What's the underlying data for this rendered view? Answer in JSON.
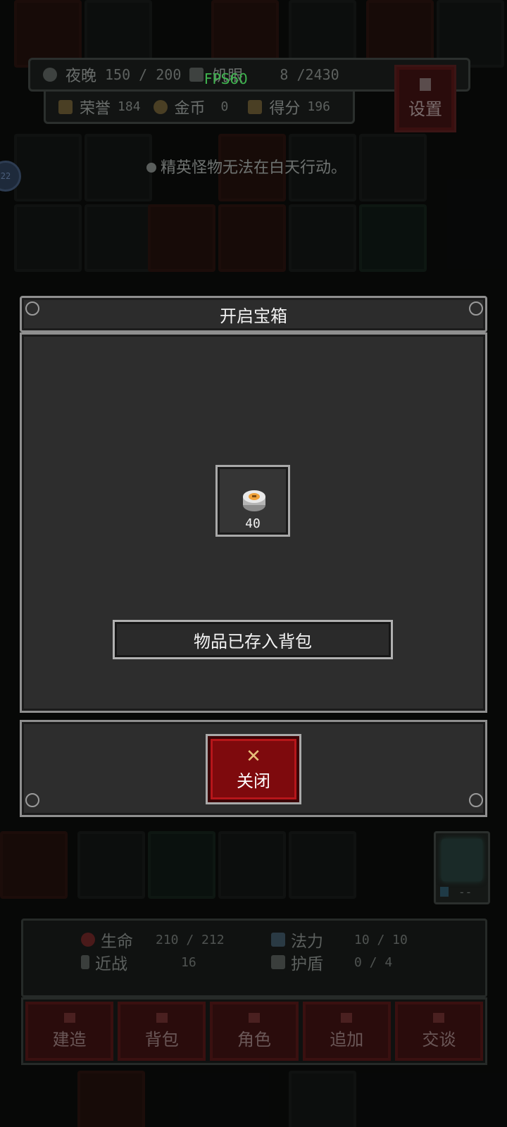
{
  "hud": {
    "fps": "FPS60",
    "phase_label": "夜晚",
    "phase_value": "150 / 200",
    "hunger_label": "饥眼",
    "hunger_value": "8 /2430",
    "honor_label": "荣誉",
    "honor_value": "184",
    "gold_label": "金币",
    "gold_value": "0",
    "score_label": "得分",
    "score_value": "196",
    "settings_label": "设置",
    "avatar_level": "22"
  },
  "notice": "精英怪物无法在白天行动。",
  "dialog": {
    "title": "开启宝箱",
    "item": {
      "icon": "silver-coin-icon",
      "quantity": "40"
    },
    "stored_message": "物品已存入背包",
    "close_label": "关闭"
  },
  "shield_slot": {
    "value": "--"
  },
  "stats": {
    "hp_label": "生命",
    "hp_value": "210 / 212",
    "mp_label": "法力",
    "mp_value": "10 / 10",
    "melee_label": "近战",
    "melee_value": "16",
    "shield_label": "护盾",
    "shield_value": "0 / 4"
  },
  "nav": [
    {
      "label": "建造",
      "icon": "hammer-icon"
    },
    {
      "label": "背包",
      "icon": "bag-icon"
    },
    {
      "label": "角色",
      "icon": "character-icon"
    },
    {
      "label": "追加",
      "icon": "plus-icon"
    },
    {
      "label": "交谈",
      "icon": "chat-icon"
    }
  ],
  "colors": {
    "close_button": "#7e0a0d",
    "fps": "#3fb54f",
    "dialog_bg": "#2d2d2d"
  }
}
